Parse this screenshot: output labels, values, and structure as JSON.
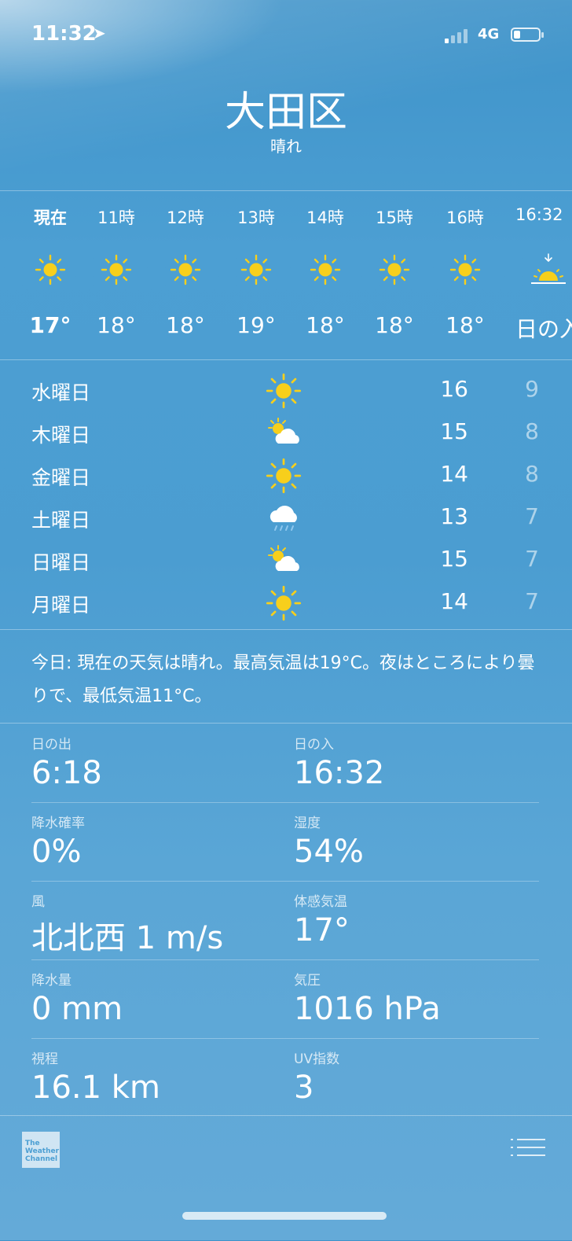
{
  "status_bar": {
    "time": "11:32",
    "network": "4G"
  },
  "location": {
    "city": "大田区",
    "condition": "晴れ"
  },
  "hourly": [
    {
      "label": "現在",
      "icon": "sun-icon",
      "temp": "17°"
    },
    {
      "label": "11時",
      "icon": "sun-icon",
      "temp": "18°"
    },
    {
      "label": "12時",
      "icon": "sun-icon",
      "temp": "18°"
    },
    {
      "label": "13時",
      "icon": "sun-icon",
      "temp": "19°"
    },
    {
      "label": "14時",
      "icon": "sun-icon",
      "temp": "18°"
    },
    {
      "label": "15時",
      "icon": "sun-icon",
      "temp": "18°"
    },
    {
      "label": "16時",
      "icon": "sun-icon",
      "temp": "18°"
    },
    {
      "label": "16:32",
      "icon": "sunset-icon",
      "temp": "日の入"
    }
  ],
  "daily": [
    {
      "day": "水曜日",
      "icon": "sun-icon",
      "high": "16",
      "low": "9"
    },
    {
      "day": "木曜日",
      "icon": "partly-cloudy-icon",
      "high": "15",
      "low": "8"
    },
    {
      "day": "金曜日",
      "icon": "sun-icon",
      "high": "14",
      "low": "8"
    },
    {
      "day": "土曜日",
      "icon": "rain-cloud-icon",
      "high": "13",
      "low": "7"
    },
    {
      "day": "日曜日",
      "icon": "partly-cloudy-icon",
      "high": "15",
      "low": "7"
    },
    {
      "day": "月曜日",
      "icon": "sun-icon",
      "high": "14",
      "low": "7"
    }
  ],
  "summary": "今日: 現在の天気は晴れ。最高気温は19°C。夜はところにより曇りで、最低気温11°C。",
  "details": [
    {
      "left": {
        "label": "日の出",
        "value": "6:18"
      },
      "right": {
        "label": "日の入",
        "value": "16:32"
      }
    },
    {
      "left": {
        "label": "降水確率",
        "value": "0%"
      },
      "right": {
        "label": "湿度",
        "value": "54%"
      }
    },
    {
      "left": {
        "label": "風",
        "value": "北北西 1 m/s"
      },
      "right": {
        "label": "体感気温",
        "value": "17°"
      }
    },
    {
      "left": {
        "label": "降水量",
        "value": "0 mm"
      },
      "right": {
        "label": "気圧",
        "value": "1016 hPa"
      }
    },
    {
      "left": {
        "label": "視程",
        "value": "16.1 km"
      },
      "right": {
        "label": "UV指数",
        "value": "3"
      }
    }
  ],
  "footer": {
    "logo_text": "The Weather Channel",
    "list_icon": "list-icon"
  },
  "colors": {
    "sun": "#f7cf1c",
    "background": "#4b9dd1"
  }
}
